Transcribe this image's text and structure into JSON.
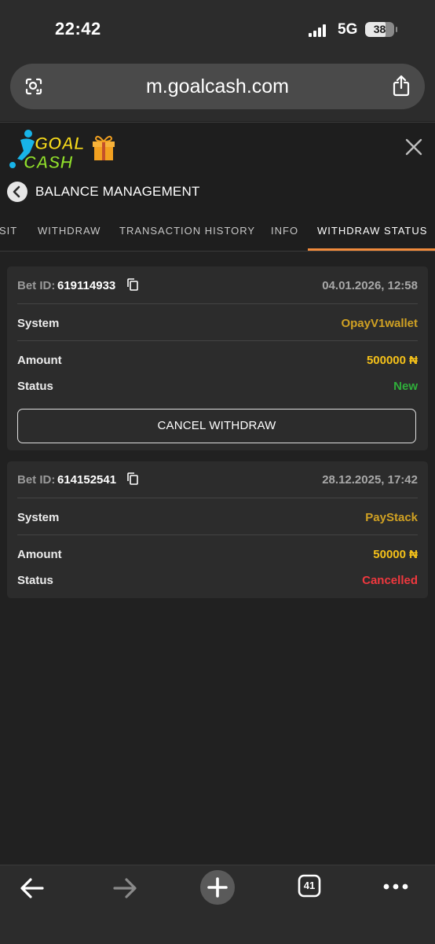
{
  "status_bar": {
    "time": "22:42",
    "network": "5G",
    "battery": "38"
  },
  "browser": {
    "url": "m.goalcash.com",
    "tab_count": "41"
  },
  "site": {
    "logo_line1": "GOAL",
    "logo_line2": "CASH"
  },
  "page": {
    "title": "BALANCE MANAGEMENT"
  },
  "tabs": [
    {
      "label": "SIT"
    },
    {
      "label": "WITHDRAW"
    },
    {
      "label": "TRANSACTION HISTORY"
    },
    {
      "label": "INFO"
    },
    {
      "label": "WITHDRAW STATUS"
    }
  ],
  "labels": {
    "bet_id": "Bet ID:",
    "system": "System",
    "amount": "Amount",
    "status": "Status"
  },
  "withdrawals": [
    {
      "bet_id": "619114933",
      "datetime": "04.01.2026, 12:58",
      "system": "OpayV1wallet",
      "amount": "500000 ₦",
      "status": "New",
      "cancel_label": "CANCEL WITHDRAW"
    },
    {
      "bet_id": "614152541",
      "datetime": "28.12.2025, 17:42",
      "system": "PayStack",
      "amount": "50000 ₦",
      "status": "Cancelled"
    }
  ],
  "colors": {
    "accent_tab": "#f08a3c",
    "system": "#d0a123",
    "amount": "#f5c119",
    "status_new": "#2fae3a",
    "status_cancelled": "#f0383e"
  },
  "icons": [
    "lens-icon",
    "share-icon",
    "close-icon",
    "back-icon",
    "copy-icon",
    "arrow-left-icon",
    "arrow-right-icon",
    "plus-icon",
    "tabs-icon",
    "more-icon",
    "gift-icon"
  ]
}
